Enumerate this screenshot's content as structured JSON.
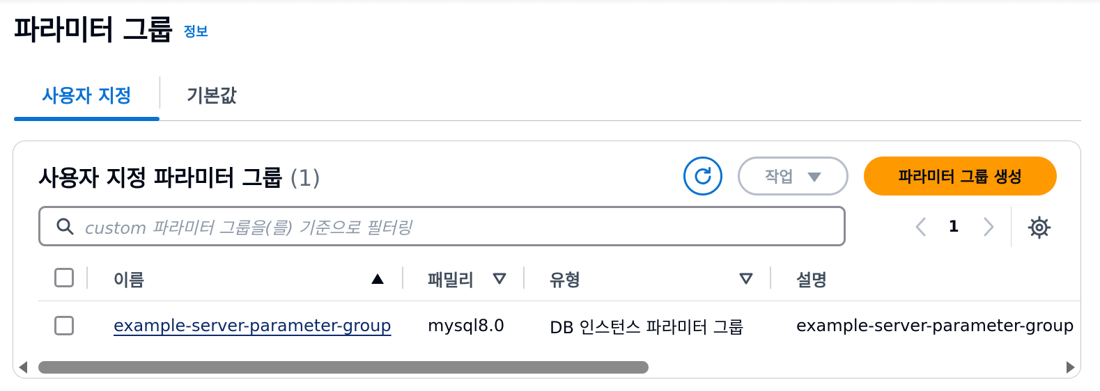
{
  "page": {
    "title": "파라미터 그룹",
    "info_link": "정보"
  },
  "tabs": [
    {
      "label": "사용자 지정",
      "selected": true
    },
    {
      "label": "기본값",
      "selected": false
    }
  ],
  "container": {
    "title": "사용자 지정 파라미터 그룹",
    "count": "(1)",
    "actions_label": "작업",
    "create_label": "파라미터 그룹 생성",
    "search_placeholder": "custom 파라미터 그룹을(를) 기준으로 필터링",
    "current_page": "1"
  },
  "table": {
    "headers": {
      "name": "이름",
      "family": "패밀리",
      "type": "유형",
      "description": "설명"
    },
    "rows": [
      {
        "name": "example-server-parameter-group",
        "family": "mysql8.0",
        "type": "DB 인스턴스 파라미터 그룹",
        "description": "example-server-parameter-group"
      }
    ]
  },
  "icons": {
    "refresh": "refresh-icon",
    "search": "search-icon",
    "settings": "gear-icon",
    "actions_caret": "caret-down-icon",
    "sort_ascending": "sort-ascending-icon",
    "sort_filter": "sort-descending-icon"
  },
  "colors": {
    "accent": "#0972d3",
    "primary_button": "#ff9900",
    "link": "#0d2a6b",
    "disabled": "#8d99a8"
  }
}
